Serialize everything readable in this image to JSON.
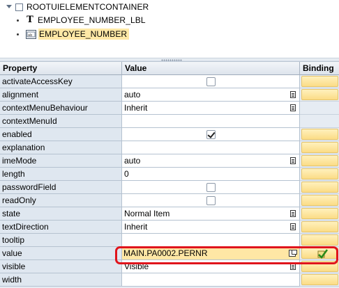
{
  "tree": {
    "root_label": "ROOTUIELEMENTCONTAINER",
    "children": [
      {
        "label": "EMPLOYEE_NUMBER_LBL",
        "icon": "text-label-icon"
      },
      {
        "label": "EMPLOYEE_NUMBER",
        "icon": "input-field-icon",
        "selected": true
      }
    ]
  },
  "grid": {
    "headers": {
      "property": "Property",
      "value": "Value",
      "binding": "Binding"
    },
    "rows": [
      {
        "property": "activateAccessKey",
        "type": "checkbox",
        "checked": false,
        "binding": true
      },
      {
        "property": "alignment",
        "type": "dropdown",
        "value": "auto",
        "binding": true
      },
      {
        "property": "contextMenuBehaviour",
        "type": "dropdown",
        "value": "Inherit",
        "binding": false
      },
      {
        "property": "contextMenuId",
        "type": "text",
        "value": "",
        "binding": false
      },
      {
        "property": "enabled",
        "type": "checkbox",
        "checked": true,
        "binding": true
      },
      {
        "property": "explanation",
        "type": "text",
        "value": "",
        "binding": true
      },
      {
        "property": "imeMode",
        "type": "dropdown",
        "value": "auto",
        "binding": true
      },
      {
        "property": "length",
        "type": "text",
        "value": "0",
        "binding": true
      },
      {
        "property": "passwordField",
        "type": "checkbox",
        "checked": false,
        "binding": true
      },
      {
        "property": "readOnly",
        "type": "checkbox",
        "checked": false,
        "binding": true
      },
      {
        "property": "state",
        "type": "dropdown",
        "value": "Normal Item",
        "binding": true
      },
      {
        "property": "textDirection",
        "type": "dropdown",
        "value": "Inherit",
        "binding": true
      },
      {
        "property": "tooltip",
        "type": "text",
        "value": "",
        "binding": true
      },
      {
        "property": "value",
        "type": "popup",
        "value": "MAIN.PA0002.PERNR",
        "binding": true,
        "bound": true,
        "highlighted": true
      },
      {
        "property": "visible",
        "type": "dropdown",
        "value": "Visible",
        "binding": true
      },
      {
        "property": "width",
        "type": "text",
        "value": "",
        "binding": true
      }
    ]
  },
  "colors": {
    "highlight": "#ffe7a5",
    "binding_button": "#fbdc86",
    "annotation": "#e0141c"
  }
}
